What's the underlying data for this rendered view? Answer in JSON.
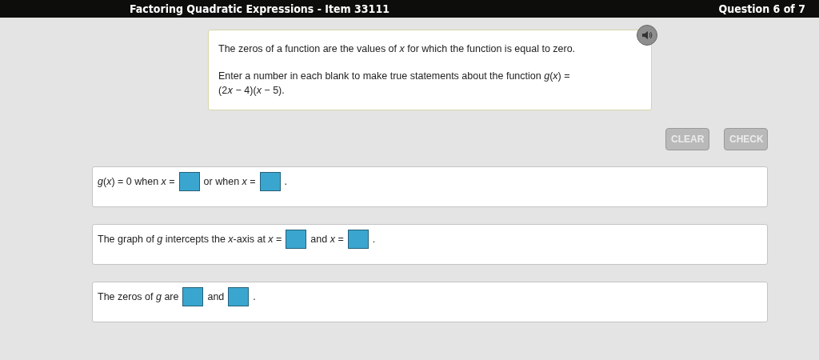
{
  "header": {
    "title": "Factoring Quadratic Expressions - Item 33111",
    "progress": "Question 6 of 7"
  },
  "intro": {
    "paragraphs": [
      "The zeros of a function are the values of *x* for which the function is equal to zero.",
      "Enter a number in each blank to make true statements about the function *g*(*x*) = (2𝑥 − 4)(*x* − 5)."
    ]
  },
  "buttons": [
    {
      "label": "CLEAR",
      "disabled": true
    },
    {
      "label": "CHECK",
      "disabled": true
    }
  ],
  "statements": [
    {
      "parts": [
        {
          "kind": "text",
          "text": "*g*(*x*) = 0 when *x* ="
        },
        {
          "kind": "blank"
        },
        {
          "kind": "text",
          "text": "or when *x* ="
        },
        {
          "kind": "blank"
        },
        {
          "kind": "text",
          "text": "."
        }
      ]
    },
    {
      "parts": [
        {
          "kind": "text",
          "text": "The graph of *g* intercepts the *x*-axis at *x* ="
        },
        {
          "kind": "blank"
        },
        {
          "kind": "text",
          "text": "and *x* ="
        },
        {
          "kind": "blank"
        },
        {
          "kind": "text",
          "text": "."
        }
      ]
    },
    {
      "parts": [
        {
          "kind": "text",
          "text": "The zeros of *g* are"
        },
        {
          "kind": "blank"
        },
        {
          "kind": "text",
          "text": "and"
        },
        {
          "kind": "blank"
        },
        {
          "kind": "text",
          "text": "."
        }
      ]
    }
  ]
}
